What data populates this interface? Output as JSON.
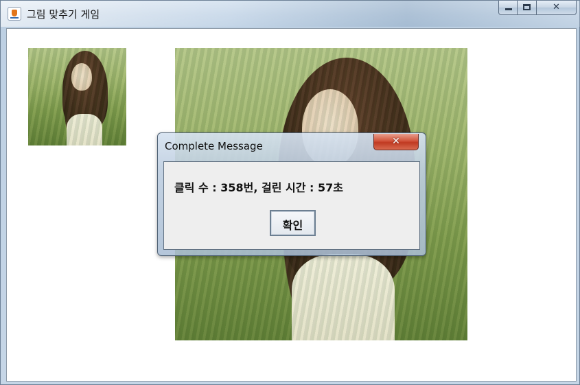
{
  "window": {
    "title": "그림 맞추기 게임",
    "icon": "java-cup-icon",
    "controls": [
      "minimize-icon",
      "maximize-icon",
      "close-icon"
    ]
  },
  "images": {
    "thumbnail": "reference-photo",
    "puzzle": "puzzle-photo"
  },
  "dialog": {
    "title": "Complete Message",
    "message": "클릭 수 : 358번, 걸린 시간 : 57초",
    "ok_label": "확인"
  },
  "colors": {
    "close_button": "#c8432a",
    "dialog_body": "#eeeeee"
  }
}
